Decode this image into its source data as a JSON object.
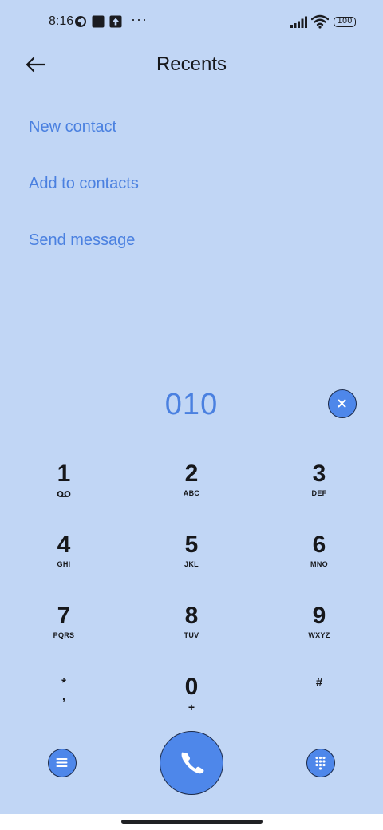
{
  "status_bar": {
    "time": "8:16",
    "more_glyph": "···",
    "battery": "100"
  },
  "header": {
    "title": "Recents"
  },
  "actions": [
    {
      "label": "New contact"
    },
    {
      "label": "Add to contacts"
    },
    {
      "label": "Send message"
    }
  ],
  "dialer": {
    "number": "010"
  },
  "keypad": [
    {
      "digit": "1",
      "letters": ""
    },
    {
      "digit": "2",
      "letters": "ABC"
    },
    {
      "digit": "3",
      "letters": "DEF"
    },
    {
      "digit": "4",
      "letters": "GHI"
    },
    {
      "digit": "5",
      "letters": "JKL"
    },
    {
      "digit": "6",
      "letters": "MNO"
    },
    {
      "digit": "7",
      "letters": "PQRS"
    },
    {
      "digit": "8",
      "letters": "TUV"
    },
    {
      "digit": "9",
      "letters": "WXYZ"
    },
    {
      "digit": "*",
      "letters": ","
    },
    {
      "digit": "0",
      "letters": "+"
    },
    {
      "digit": "#",
      "letters": ""
    }
  ],
  "icons": {
    "voicemail": "voicemail-icon",
    "clear": "close-icon",
    "menu": "menu-icon",
    "call": "phone-icon",
    "dialpad": "dialpad-icon"
  },
  "colors": {
    "background": "#c1d6f5",
    "accent": "#4a80e0",
    "button": "#4e87ea"
  }
}
